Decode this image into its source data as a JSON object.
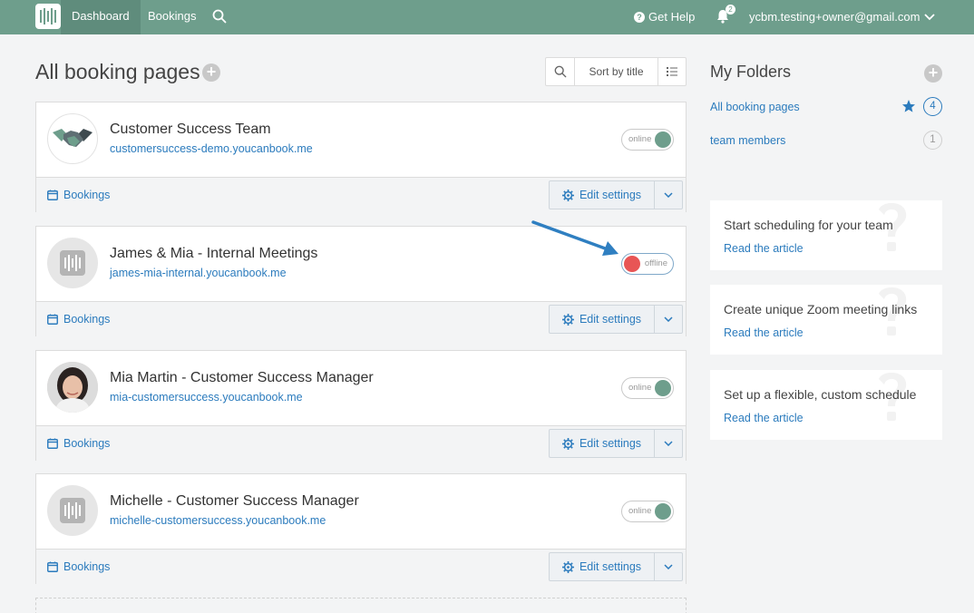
{
  "nav": {
    "dashboard": "Dashboard",
    "bookings": "Bookings",
    "help": "Get Help",
    "notification_count": "2",
    "user_email": "ycbm.testing+owner@gmail.com"
  },
  "main": {
    "title": "All booking pages",
    "sort_label": "Sort by title"
  },
  "pages": [
    {
      "name": "Customer Success Team",
      "url": "customersuccess-demo.youcanbook.me",
      "status": "online",
      "avatar": "handshake-icon",
      "bookings_label": "Bookings",
      "edit_label": "Edit settings"
    },
    {
      "name": "James & Mia - Internal Meetings",
      "url": "james-mia-internal.youcanbook.me",
      "status": "offline",
      "avatar": "ycbm-logo",
      "bookings_label": "Bookings",
      "edit_label": "Edit settings"
    },
    {
      "name": "Mia Martin - Customer Success Manager",
      "url": "mia-customersuccess.youcanbook.me",
      "status": "online",
      "avatar": "profile-photo",
      "bookings_label": "Bookings",
      "edit_label": "Edit settings"
    },
    {
      "name": "Michelle - Customer Success Manager",
      "url": "michelle-customersuccess.youcanbook.me",
      "status": "online",
      "avatar": "ycbm-logo",
      "bookings_label": "Bookings",
      "edit_label": "Edit settings"
    }
  ],
  "folders": {
    "title": "My Folders",
    "items": [
      {
        "label": "All booking pages",
        "count": "4",
        "starred": true
      },
      {
        "label": "team members",
        "count": "1",
        "starred": false
      }
    ]
  },
  "articles": [
    {
      "title": "Start scheduling for your team",
      "link": "Read the article"
    },
    {
      "title": "Create unique Zoom meeting links",
      "link": "Read the article"
    },
    {
      "title": "Set up a flexible, custom schedule",
      "link": "Read the article"
    }
  ],
  "colors": {
    "topbar": "#6e9e8c",
    "link": "#2b7bbd",
    "online_knob": "#6e9e8c",
    "offline_knob": "#e85555"
  }
}
